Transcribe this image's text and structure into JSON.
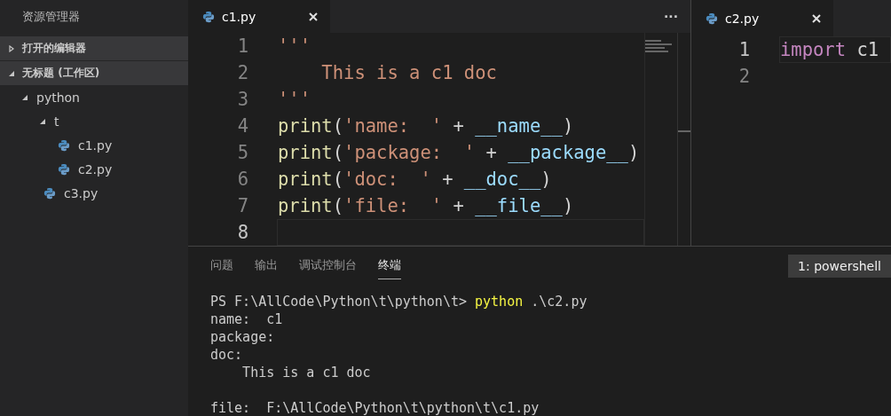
{
  "sidebar": {
    "title": "资源管理器",
    "sections": [
      {
        "label": "打开的编辑器",
        "expanded": false
      },
      {
        "label": "无标题 (工作区)",
        "expanded": true,
        "items": [
          {
            "label": "python",
            "kind": "folder",
            "expanded": true,
            "children": [
              {
                "label": "t",
                "kind": "folder",
                "expanded": true,
                "children": [
                  {
                    "label": "c1.py",
                    "kind": "file"
                  },
                  {
                    "label": "c2.py",
                    "kind": "file"
                  }
                ]
              },
              {
                "label": "c3.py",
                "kind": "file"
              }
            ]
          }
        ]
      }
    ]
  },
  "editors": [
    {
      "tabs": [
        {
          "label": "c1.py",
          "selected": true
        }
      ],
      "more": "···",
      "minimap": true,
      "lines": [
        {
          "number": "1",
          "current": false,
          "tokens": [
            {
              "text": "'''",
              "kind": "string"
            }
          ]
        },
        {
          "number": "2",
          "current": false,
          "tokens": [
            {
              "text": "    This is a c1 doc",
              "kind": "string"
            }
          ]
        },
        {
          "number": "3",
          "current": false,
          "tokens": [
            {
              "text": "'''",
              "kind": "string"
            }
          ]
        },
        {
          "number": "4",
          "current": false,
          "tokens": [
            {
              "text": "print",
              "kind": "func"
            },
            {
              "text": "(",
              "kind": "plain"
            },
            {
              "text": "'name:  '",
              "kind": "string"
            },
            {
              "text": " + ",
              "kind": "plain"
            },
            {
              "text": "__name__",
              "kind": "var"
            },
            {
              "text": ")",
              "kind": "plain"
            }
          ]
        },
        {
          "number": "5",
          "current": false,
          "tokens": [
            {
              "text": "print",
              "kind": "func"
            },
            {
              "text": "(",
              "kind": "plain"
            },
            {
              "text": "'package:  '",
              "kind": "string"
            },
            {
              "text": " + ",
              "kind": "plain"
            },
            {
              "text": "__package__",
              "kind": "var"
            },
            {
              "text": ")",
              "kind": "plain"
            }
          ]
        },
        {
          "number": "6",
          "current": false,
          "tokens": [
            {
              "text": "print",
              "kind": "func"
            },
            {
              "text": "(",
              "kind": "plain"
            },
            {
              "text": "'doc:  '",
              "kind": "string"
            },
            {
              "text": " + ",
              "kind": "plain"
            },
            {
              "text": "__doc__",
              "kind": "var"
            },
            {
              "text": ")",
              "kind": "plain"
            }
          ]
        },
        {
          "number": "7",
          "current": false,
          "tokens": [
            {
              "text": "print",
              "kind": "func"
            },
            {
              "text": "(",
              "kind": "plain"
            },
            {
              "text": "'file:  '",
              "kind": "string"
            },
            {
              "text": " + ",
              "kind": "plain"
            },
            {
              "text": "__file__",
              "kind": "var"
            },
            {
              "text": ")",
              "kind": "plain"
            }
          ]
        },
        {
          "number": "8",
          "current": true
        }
      ]
    },
    {
      "tabs": [
        {
          "label": "c2.py",
          "selected": true
        }
      ],
      "lines": [
        {
          "number": "1",
          "current": true,
          "tokens": [
            {
              "text": "import",
              "kind": "keyword"
            },
            {
              "text": " c1",
              "kind": "plain"
            }
          ]
        },
        {
          "number": "2",
          "current": false
        }
      ]
    }
  ],
  "panel": {
    "tabs": [
      {
        "label": "问题",
        "selected": false
      },
      {
        "label": "输出",
        "selected": false
      },
      {
        "label": "调试控制台",
        "selected": false
      },
      {
        "label": "终端",
        "selected": true
      }
    ],
    "terminal_select": "1: powershell",
    "terminal_lines": [
      {
        "kind": "output",
        "segments": [
          {
            "text": "PS F:\\AllCode\\Python\\t\\python\\t> ",
            "kind": "plain"
          },
          {
            "text": "python",
            "kind": "command"
          },
          {
            "text": " .\\c2.py",
            "kind": "plain"
          }
        ]
      },
      {
        "kind": "output",
        "segments": [
          {
            "text": "name:  c1",
            "kind": "plain"
          }
        ]
      },
      {
        "kind": "output",
        "segments": [
          {
            "text": "package:",
            "kind": "plain"
          }
        ]
      },
      {
        "kind": "output",
        "segments": [
          {
            "text": "doc:",
            "kind": "plain"
          }
        ]
      },
      {
        "kind": "output",
        "segments": [
          {
            "text": "    This is a c1 doc",
            "kind": "plain"
          }
        ]
      },
      {
        "kind": "blank"
      },
      {
        "kind": "output",
        "segments": [
          {
            "text": "file:  F:\\AllCode\\Python\\t\\python\\t\\c1.py",
            "kind": "plain"
          }
        ]
      }
    ]
  }
}
